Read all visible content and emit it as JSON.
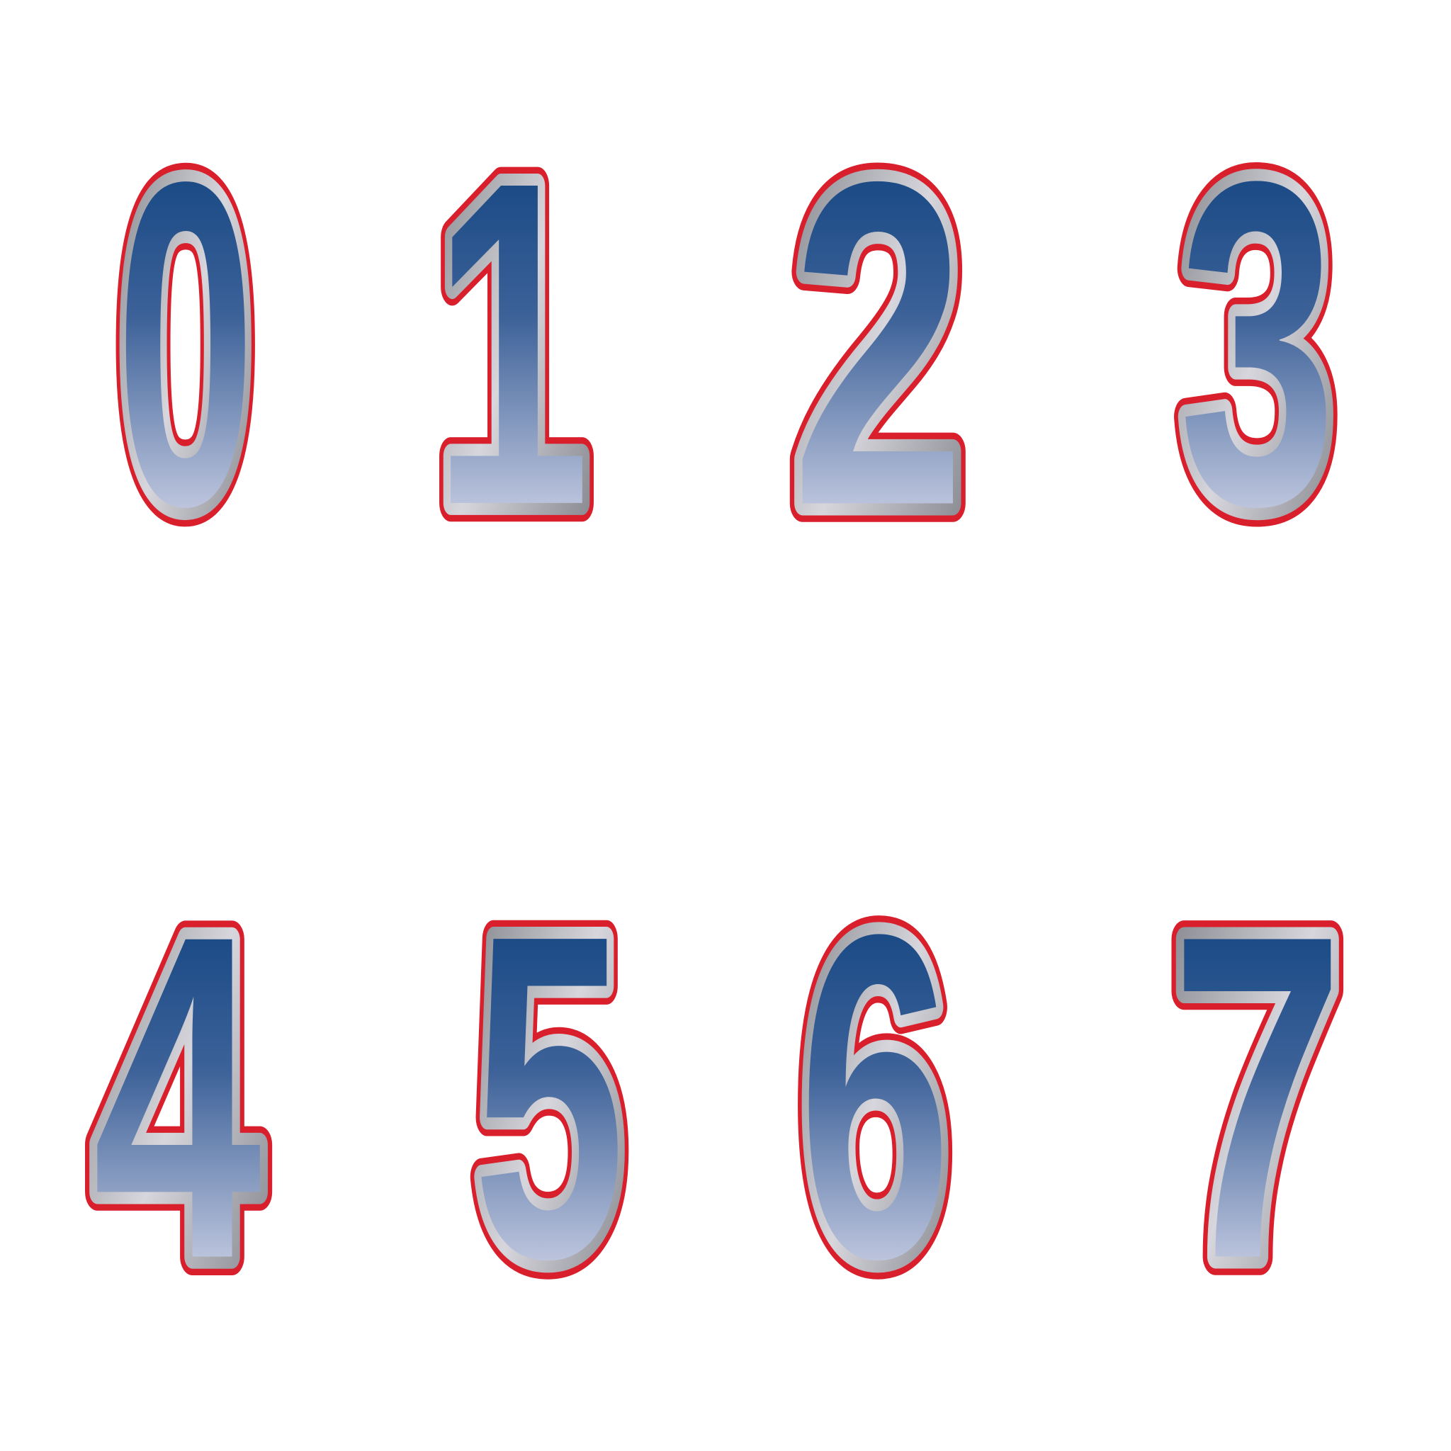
{
  "rows": [
    {
      "digits": [
        "0",
        "1",
        "2",
        "3"
      ]
    },
    {
      "digits": [
        "4",
        "5",
        "6",
        "7"
      ]
    }
  ],
  "colors": {
    "fill_top": "#033a78",
    "fill_bottom": "#d2d5e8",
    "silver_dark": "#7c7c84",
    "silver_light": "#d6d6dc",
    "outline_red": "#d81f2b",
    "background": "#ffffff"
  }
}
